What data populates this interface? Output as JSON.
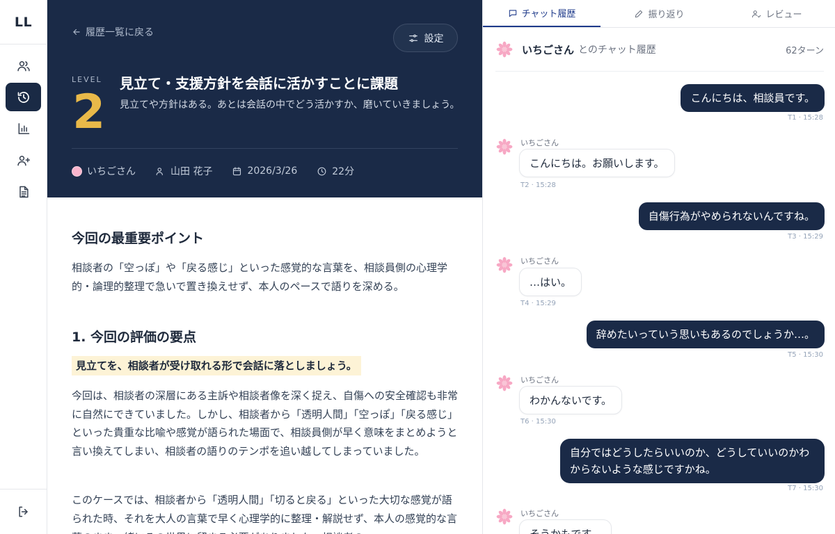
{
  "app": {
    "logo": "LL"
  },
  "sidebar": {
    "items": [
      {
        "name": "users-icon"
      },
      {
        "name": "history-icon",
        "active": true
      },
      {
        "name": "chart-icon"
      },
      {
        "name": "user-plus-icon"
      },
      {
        "name": "document-icon"
      }
    ],
    "bottom_icon": "logout-icon"
  },
  "header": {
    "back_label": "履歴一覧に戻る",
    "settings_label": "設定",
    "level_label": "LEVEL",
    "level_number": "2",
    "title": "見立て・支援方針を会話に活かすことに課題",
    "description": "見立てや方針はある。あとは会話の中でどう活かすか、磨いていきましょう。",
    "meta": {
      "client": "いちごさん",
      "counselor": "山田 花子",
      "date": "2026/3/26",
      "duration": "22分"
    }
  },
  "content": {
    "point_heading": "今回の最重要ポイント",
    "point_text": "相談者の「空っぽ」や「戻る感じ」といった感覚的な言葉を、相談員側の心理学的・論理的整理で急いで置き換えせず、本人のペースで語りを深める。",
    "eval_heading": "1. 今回の評価の要点",
    "eval_highlight": "見立てを、相談者が受け取れる形で会話に落としましょう。",
    "eval_body1": "今回は、相談者の深層にある主訴や相談者像を深く捉え、自傷への安全確認も非常に自然にできていました。しかし、相談者から「透明人間」「空っぽ」「戻る感じ」といった貴重な比喩や感覚が語られた場面で、相談員側が早く意味をまとめようと言い換えてしまい、相談者の語りのテンポを追い越してしまっていました。",
    "eval_body2": "このケースでは、相談者から「透明人間」「切ると戻る」といった大切な感覚が語られた時、それを大人の言葉で早く心理学的に整理・解説せず、本人の感覚的な言葉のまま一緒にその世界に留まる必要がありました。相談者の"
  },
  "panel": {
    "tabs": [
      {
        "label": "チャット履歴",
        "icon": "chat-icon",
        "active": true
      },
      {
        "label": "振り返り",
        "icon": "pencil-icon"
      },
      {
        "label": "レビュー",
        "icon": "user-review-icon"
      }
    ],
    "chat_name": "いちごさん",
    "chat_sub": "とのチャット履歴",
    "turns": "62ターン",
    "messages": [
      {
        "role": "user",
        "text": "こんにちは、相談員です。",
        "stamp": "T1 · 15:28"
      },
      {
        "role": "bot",
        "sender": "いちごさん",
        "text": "こんにちは。お願いします。",
        "stamp": "T2 · 15:28"
      },
      {
        "role": "user",
        "text": "自傷行為がやめられないんですね。",
        "stamp": "T3 · 15:29"
      },
      {
        "role": "bot",
        "sender": "いちごさん",
        "text": "…はい。",
        "stamp": "T4 · 15:29"
      },
      {
        "role": "user",
        "text": "辞めたいっていう思いもあるのでしょうか…。",
        "stamp": "T5 · 15:30"
      },
      {
        "role": "bot",
        "sender": "いちごさん",
        "text": "わかんないです。",
        "stamp": "T6 · 15:30"
      },
      {
        "role": "user",
        "text": "自分ではどうしたらいいのか、どうしていいのかわからないような感じですかね。",
        "stamp": "T7 · 15:30"
      },
      {
        "role": "bot",
        "sender": "いちごさん",
        "text": "そうかもです。",
        "stamp": ""
      }
    ]
  }
}
